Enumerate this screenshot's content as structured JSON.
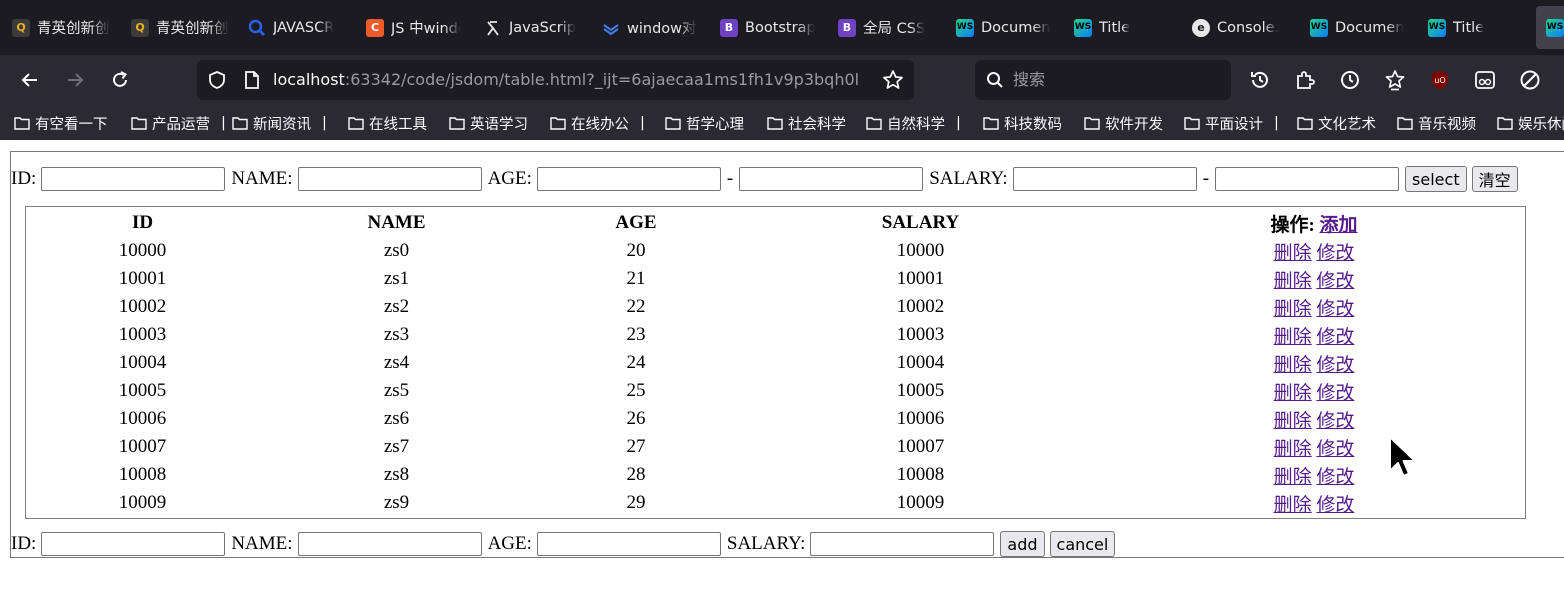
{
  "browser": {
    "tabs": [
      {
        "label": "青英创新创",
        "icon": "qingying-icon",
        "color": "#3b3b3b"
      },
      {
        "label": "青英创新创",
        "icon": "qingying-icon",
        "color": "#3b3b3b"
      },
      {
        "label": "JAVASCR",
        "icon": "search-icon",
        "color": "#2a61e8"
      },
      {
        "label": "JS 中windo",
        "icon": "c-icon",
        "color": "#ef5a2b"
      },
      {
        "label": "JavaScrip",
        "icon": "lambda-icon",
        "color": "#e8e8ea"
      },
      {
        "label": "window对",
        "icon": "layers-icon",
        "color": "#3e7cf0"
      },
      {
        "label": "Bootstrap",
        "icon": "bootstrap-icon",
        "color": "#6f42c1"
      },
      {
        "label": "全局 CSS",
        "icon": "bootstrap-icon",
        "color": "#6f42c1"
      },
      {
        "label": "Documen",
        "icon": "webstorm-icon",
        "color": "#21d789"
      },
      {
        "label": "Title",
        "icon": "webstorm-icon",
        "color": "#21d789"
      },
      {
        "label": "Console.",
        "icon": "edge-e-icon",
        "color": "#e8e8ea"
      },
      {
        "label": "Documen",
        "icon": "webstorm-icon",
        "color": "#21d789"
      },
      {
        "label": "Title",
        "icon": "webstorm-icon",
        "color": "#21d789"
      },
      {
        "label": "",
        "icon": "webstorm-icon",
        "color": "#21d789"
      }
    ],
    "url_host": "localhost",
    "url_rest": ":63342/code/jsdom/table.html?_ijt=6ajaecaa1ms1fh1v9p3bqh0l",
    "search_placeholder": "搜索",
    "bookmarks": [
      {
        "label": "有空看一下",
        "sep": ""
      },
      {
        "label": "产品运营",
        "sep": "|"
      },
      {
        "label": "新闻资讯",
        "sep": "|"
      },
      {
        "label": "在线工具",
        "sep": ""
      },
      {
        "label": "英语学习",
        "sep": ""
      },
      {
        "label": "在线办公",
        "sep": "|"
      },
      {
        "label": "哲学心理",
        "sep": ""
      },
      {
        "label": "社会科学",
        "sep": ""
      },
      {
        "label": "自然科学",
        "sep": "|"
      },
      {
        "label": "科技数码",
        "sep": ""
      },
      {
        "label": "软件开发",
        "sep": ""
      },
      {
        "label": "平面设计",
        "sep": "|"
      },
      {
        "label": "文化艺术",
        "sep": ""
      },
      {
        "label": "音乐视频",
        "sep": ""
      },
      {
        "label": "娱乐休闲",
        "sep": ""
      }
    ]
  },
  "search_form": {
    "id_label": "ID:",
    "name_label": "NAME:",
    "age_label": "AGE:",
    "salary_label": "SALARY:",
    "range_sep": "-",
    "select_button": "select",
    "clear_button": "清空"
  },
  "table": {
    "headers": {
      "id": "ID",
      "name": "NAME",
      "age": "AGE",
      "salary": "SALARY",
      "ops": "操作:",
      "add_link": "添加"
    },
    "delete_label": "删除",
    "edit_label": "修改",
    "rows": [
      {
        "id": "10000",
        "name": "zs0",
        "age": "20",
        "salary": "10000"
      },
      {
        "id": "10001",
        "name": "zs1",
        "age": "21",
        "salary": "10001"
      },
      {
        "id": "10002",
        "name": "zs2",
        "age": "22",
        "salary": "10002"
      },
      {
        "id": "10003",
        "name": "zs3",
        "age": "23",
        "salary": "10003"
      },
      {
        "id": "10004",
        "name": "zs4",
        "age": "24",
        "salary": "10004"
      },
      {
        "id": "10005",
        "name": "zs5",
        "age": "25",
        "salary": "10005"
      },
      {
        "id": "10006",
        "name": "zs6",
        "age": "26",
        "salary": "10006"
      },
      {
        "id": "10007",
        "name": "zs7",
        "age": "27",
        "salary": "10007"
      },
      {
        "id": "10008",
        "name": "zs8",
        "age": "28",
        "salary": "10008"
      },
      {
        "id": "10009",
        "name": "zs9",
        "age": "29",
        "salary": "10009"
      }
    ]
  },
  "add_form": {
    "id_label": "ID:",
    "name_label": "NAME:",
    "age_label": "AGE:",
    "salary_label": "SALARY:",
    "add_button": "add",
    "cancel_button": "cancel"
  }
}
